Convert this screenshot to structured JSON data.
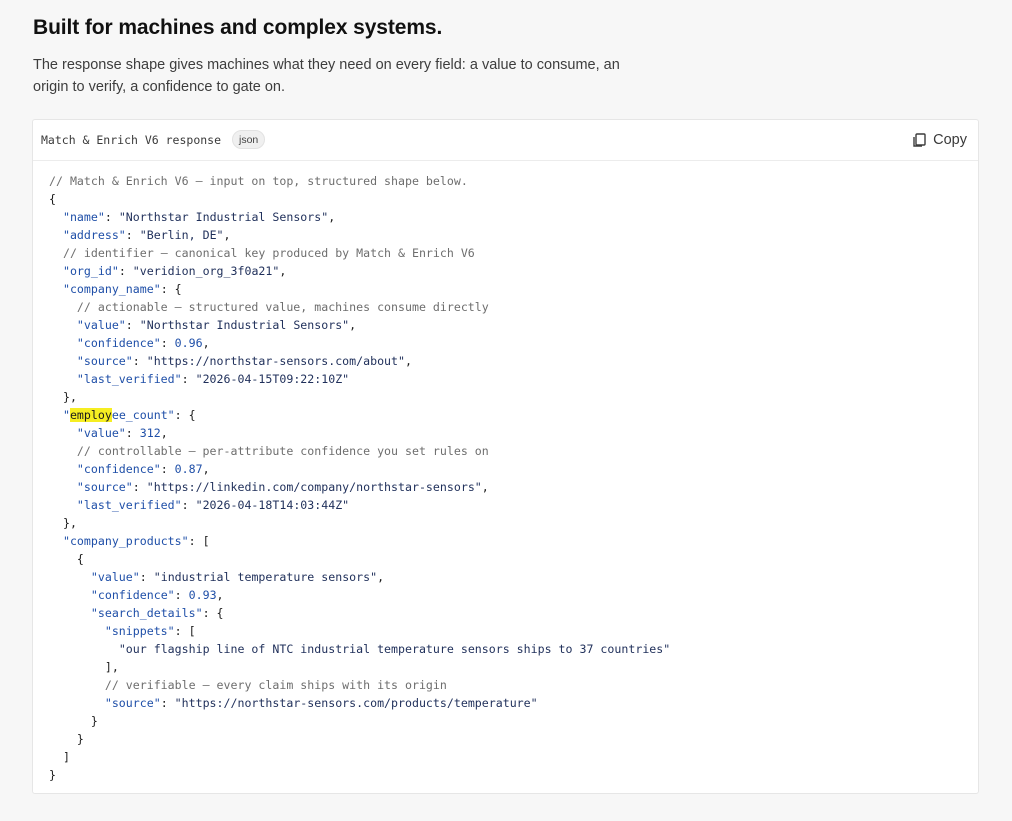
{
  "section": {
    "title": "Built for machines and complex systems.",
    "description": "The response shape gives machines what they need on every field: a value to consume, an origin to verify, a confidence to gate on."
  },
  "code_block": {
    "title": "Match & Enrich V6 response",
    "language_badge": "json",
    "copy_label": "Copy",
    "copy_icon": "copy-icon",
    "highlight_text": "employ",
    "colors": {
      "key": "#1f4fa8",
      "comment": "#6e6e6e",
      "string": "#1f2f5a",
      "highlight": "#f6ee22"
    },
    "lines": [
      "// Match & Enrich V6 — input on top, structured shape below.",
      "{",
      "  \"name\": \"Northstar Industrial Sensors\",",
      "  \"address\": \"Berlin, DE\",",
      "  // identifier — canonical key produced by Match & Enrich V6",
      "  \"org_id\": \"veridion_org_3f0a21\",",
      "  \"company_name\": {",
      "    // actionable — structured value, machines consume directly",
      "    \"value\": \"Northstar Industrial Sensors\",",
      "    \"confidence\": 0.96,",
      "    \"source\": \"https://northstar-sensors.com/about\",",
      "    \"last_verified\": \"2026-04-15T09:22:10Z\"",
      "  },",
      "  \"employee_count\": {",
      "    \"value\": 312,",
      "    // controllable — per-attribute confidence you set rules on",
      "    \"confidence\": 0.87,",
      "    \"source\": \"https://linkedin.com/company/northstar-sensors\",",
      "    \"last_verified\": \"2026-04-18T14:03:44Z\"",
      "  },",
      "  \"company_products\": [",
      "    {",
      "      \"value\": \"industrial temperature sensors\",",
      "      \"confidence\": 0.93,",
      "      \"search_details\": {",
      "        \"snippets\": [",
      "          \"our flagship line of NTC industrial temperature sensors ships to 37 countries\"",
      "        ],",
      "        // verifiable — every claim ships with its origin",
      "        \"source\": \"https://northstar-sensors.com/products/temperature\"",
      "      }",
      "    }",
      "  ]",
      "}"
    ]
  }
}
